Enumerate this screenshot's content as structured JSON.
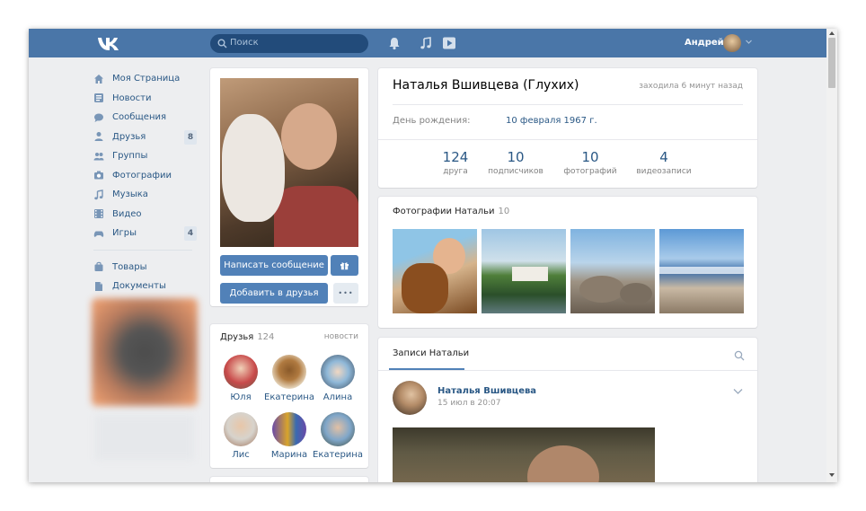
{
  "topbar": {
    "search_placeholder": "Поиск",
    "user_name": "Андрей"
  },
  "leftnav": {
    "items": [
      {
        "label": "Моя Страница",
        "icon": "home-icon",
        "count": ""
      },
      {
        "label": "Новости",
        "icon": "news-icon",
        "count": ""
      },
      {
        "label": "Сообщения",
        "icon": "messages-icon",
        "count": ""
      },
      {
        "label": "Друзья",
        "icon": "friends-icon",
        "count": "8"
      },
      {
        "label": "Группы",
        "icon": "groups-icon",
        "count": ""
      },
      {
        "label": "Фотографии",
        "icon": "camera-icon",
        "count": ""
      },
      {
        "label": "Музыка",
        "icon": "music-icon",
        "count": ""
      },
      {
        "label": "Видео",
        "icon": "video-icon",
        "count": ""
      },
      {
        "label": "Игры",
        "icon": "gamepad-icon",
        "count": "4"
      }
    ],
    "extra_items": [
      {
        "label": "Товары",
        "icon": "bag-icon"
      },
      {
        "label": "Документы",
        "icon": "document-icon"
      }
    ]
  },
  "profile": {
    "write_message": "Написать сообщение",
    "add_friend": "Добавить в друзья",
    "more": "•••"
  },
  "friends": {
    "title": "Друзья",
    "count": "124",
    "news_link": "новости",
    "list": [
      {
        "name": "Юля",
        "color_a": "#c84a4a",
        "color_b": "#6b5b4a"
      },
      {
        "name": "Екатерина",
        "color_a": "#e9dcc6",
        "color_b": "#8a5a2a"
      },
      {
        "name": "Алина",
        "color_a": "#8fb8d8",
        "color_b": "#3b4a5c"
      },
      {
        "name": "Лис",
        "color_a": "#d7d3cc",
        "color_b": "#a0735a"
      },
      {
        "name": "Марина",
        "color_a": "#6a4aa8",
        "color_b": "#d9a42a"
      },
      {
        "name": "Екатерина",
        "color_a": "#7fa6c9",
        "color_b": "#3f4b3a"
      }
    ]
  },
  "info": {
    "name": "Наталья Вшивцева (Глухих)",
    "last_seen": "заходила 6 минут назад",
    "birthday_label": "День рождения:",
    "birthday_value": "10 февраля 1967 г.",
    "counters": [
      {
        "value": "124",
        "label": "друга"
      },
      {
        "value": "10",
        "label": "подписчиков"
      },
      {
        "value": "10",
        "label": "фотографий"
      },
      {
        "value": "4",
        "label": "видеозаписи"
      }
    ]
  },
  "photos": {
    "title": "Фотографии Натальи",
    "count": "10"
  },
  "wall": {
    "tab": "Записи Натальи",
    "post_author": "Наталья Вшивцева",
    "post_date": "15 июл в 20:07"
  },
  "colors": {
    "header": "#4a76a8",
    "link": "#2a5885",
    "button": "#5181b8",
    "background": "#edeef0"
  }
}
